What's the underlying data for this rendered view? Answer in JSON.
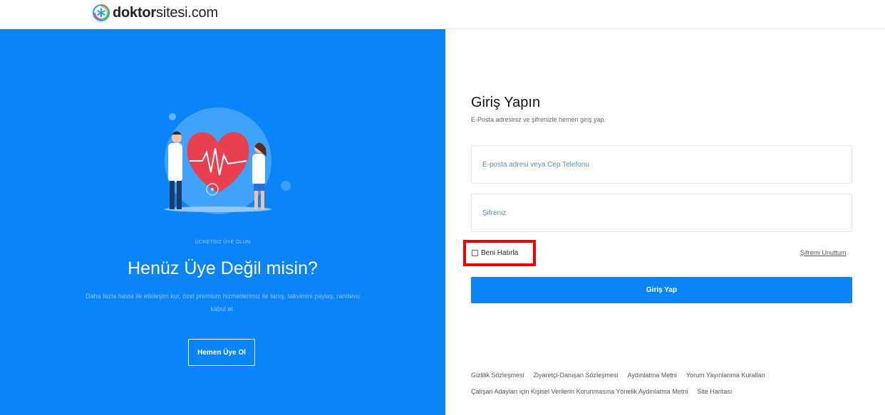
{
  "brand": {
    "bold": "doktor",
    "regular": "sitesi.com",
    "logo_icon": "asterisk-circle-icon",
    "logo_colors": [
      "#f6a623",
      "#7ac143",
      "#1aa3e8",
      "#e94e77"
    ]
  },
  "colors": {
    "primary": "#0a84f7",
    "highlight": "#ef0000"
  },
  "promo": {
    "kicker": "ÜCRETSİZ ÜYE OLUN",
    "title": "Henüz Üye Değil misin?",
    "text": "Daha fazla hasta ile etkileşim kur, özel premium hizmetlerimiz ile tanış, takvimini paylaş, randevu kabul et.",
    "button": "Hemen Üye Ol",
    "illustration": "doctors-heart-illustration"
  },
  "login": {
    "title": "Giriş Yapın",
    "subtitle": "E-Posta adresiniz ve şifrenizle hemen giriş yap.",
    "email_placeholder": "E-posta adresi veya Cep Telefonu",
    "email_value": "",
    "password_placeholder": "Şifreniz",
    "password_value": "",
    "remember_label": "Beni Hatırla",
    "remember_checked": false,
    "forgot_label": "Şifremi Unuttum",
    "submit_label": "Giriş Yap"
  },
  "footer": {
    "row1": [
      "Gizlilik Sözleşmesi",
      "Ziyaretçi-Danışan Sözleşmesi",
      "Aydınlatma Metni",
      "Yorum Yayınlanma Kuralları"
    ],
    "row2": [
      "Çalışan Adayları için Kişisel Verilerin Korunmasına Yönelik Aydınlatma Metni",
      "Site Haritası"
    ]
  }
}
